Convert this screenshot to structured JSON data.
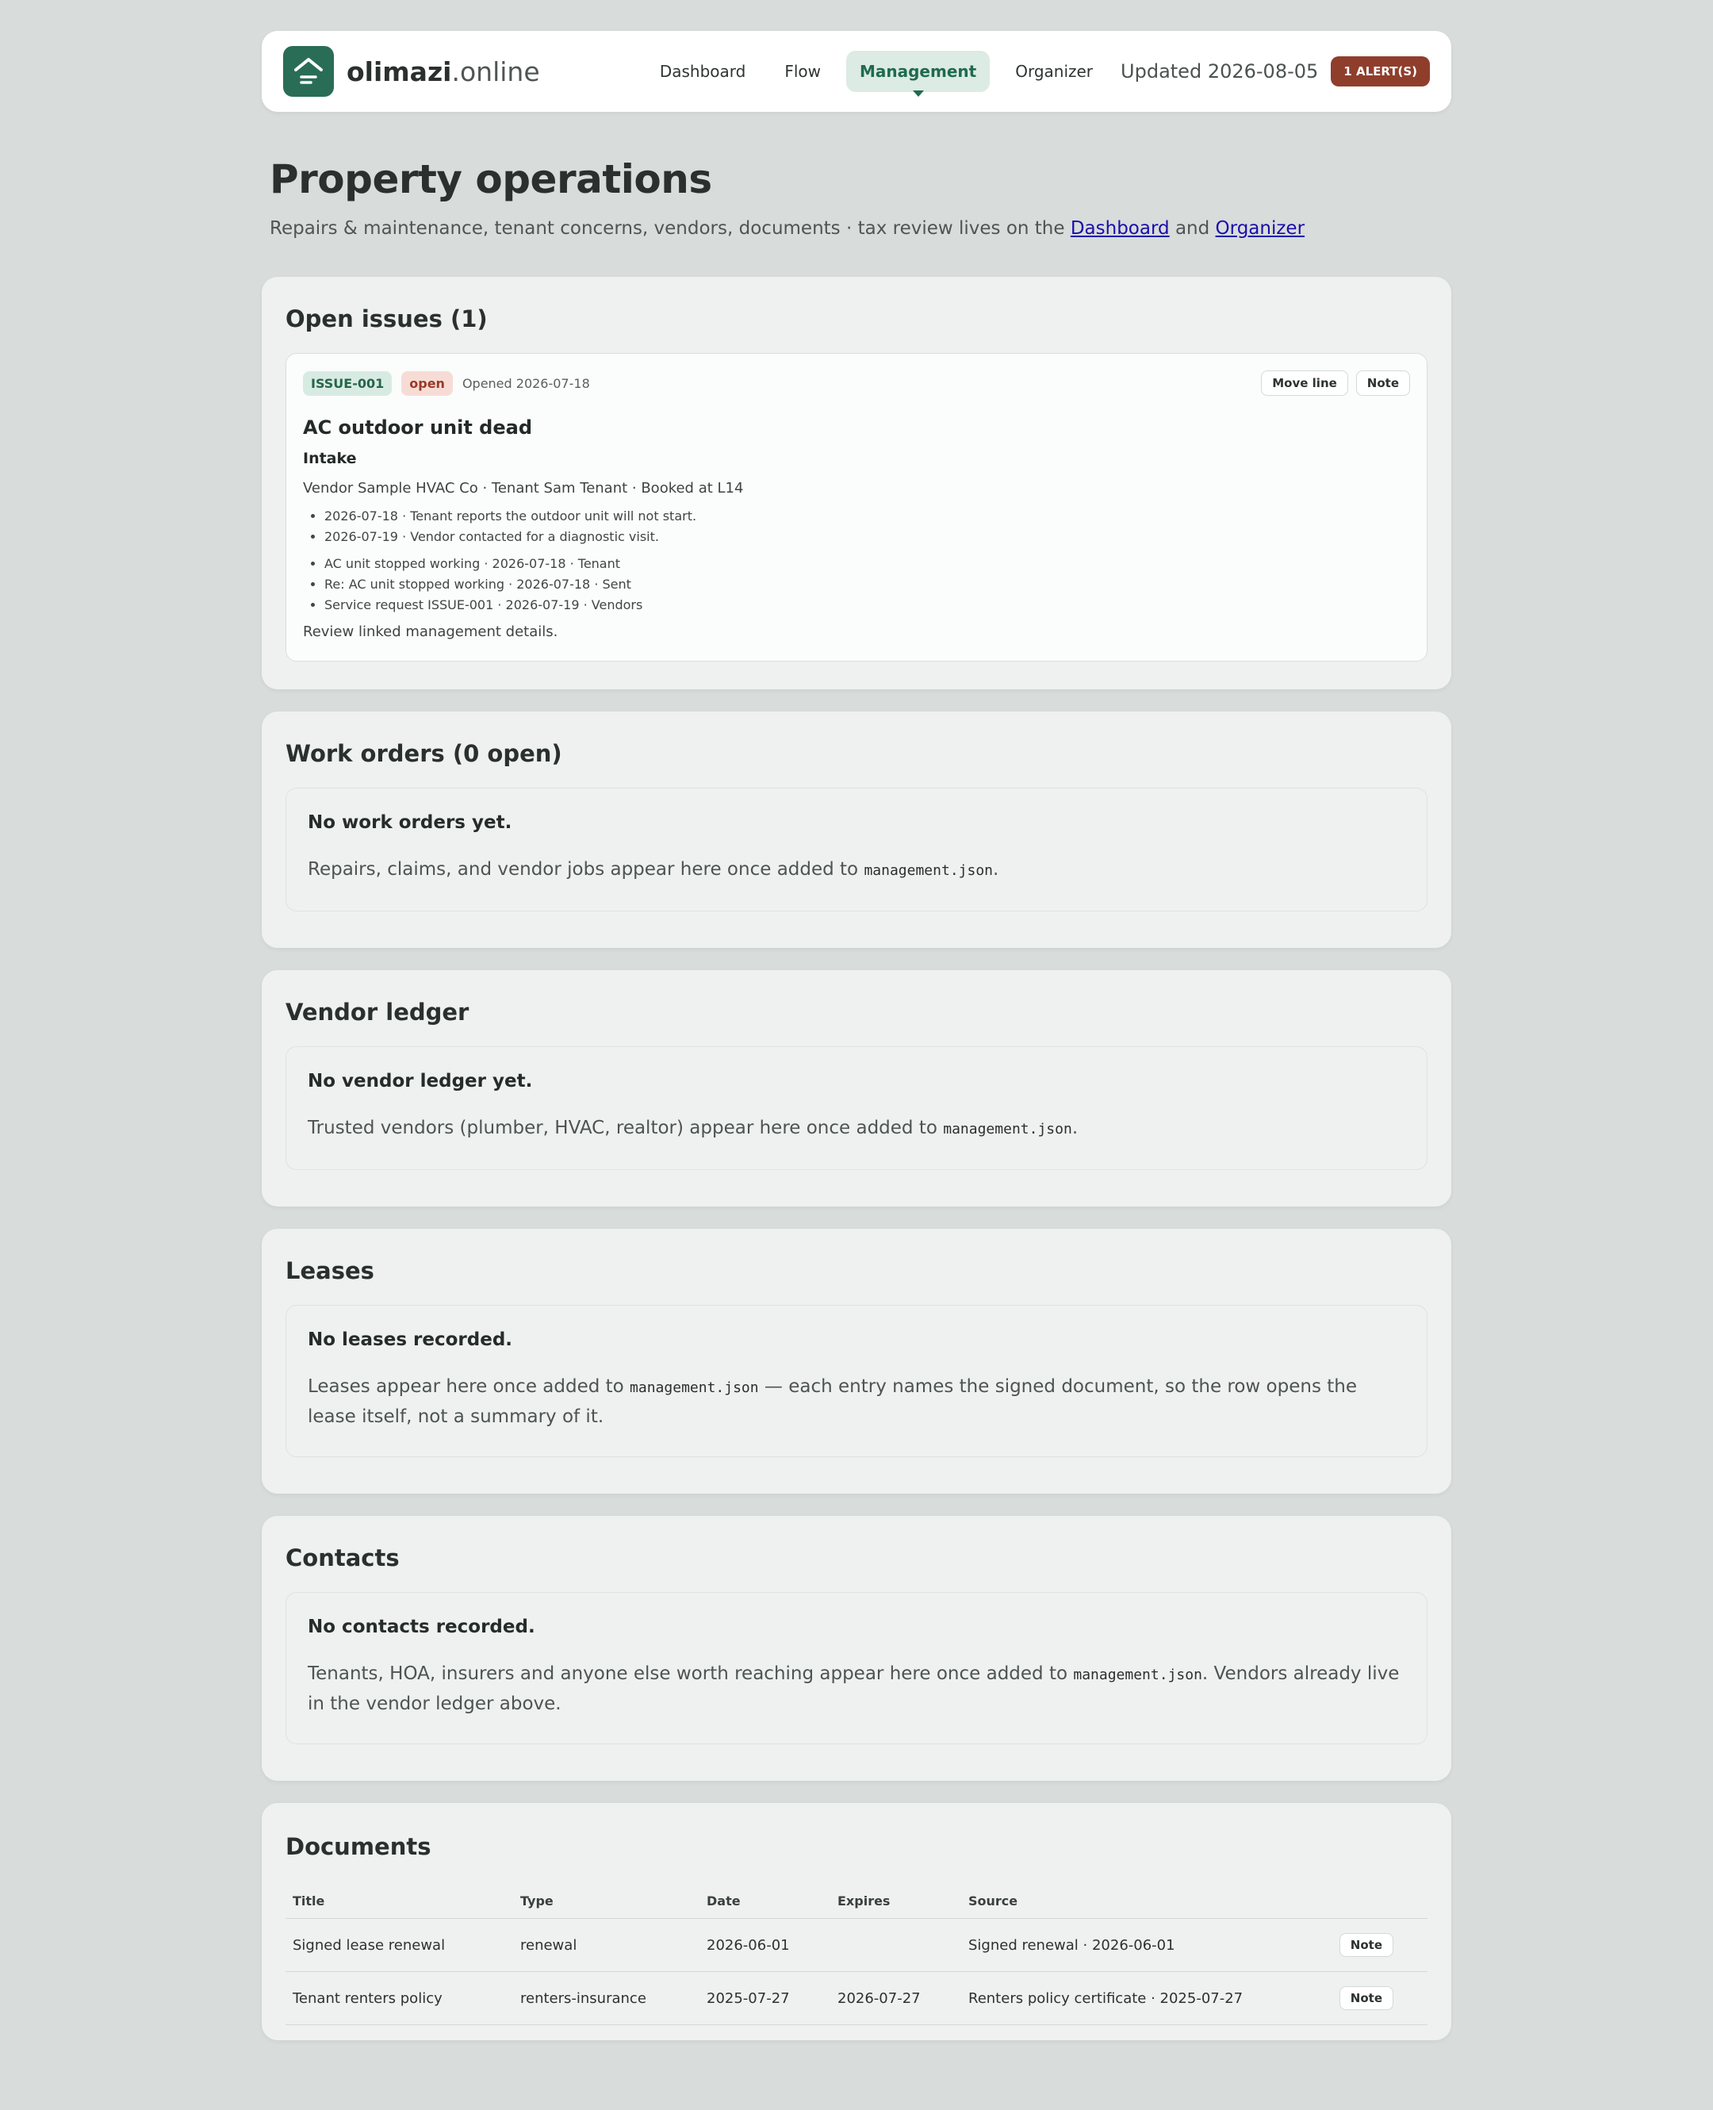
{
  "header": {
    "brand_bold": "olimazi",
    "brand_light": ".online",
    "nav": [
      {
        "label": "Dashboard"
      },
      {
        "label": "Flow"
      },
      {
        "label": "Management"
      },
      {
        "label": "Organizer"
      }
    ],
    "updated": "Updated 2026-08-05",
    "alerts": "1 ALERT(S)"
  },
  "page": {
    "title": "Property operations",
    "subtitle_prefix": "Repairs & maintenance, tenant concerns, vendors, documents · tax review lives on the ",
    "link_dashboard": "Dashboard",
    "subtitle_and": " and ",
    "link_organizer": "Organizer"
  },
  "issues": {
    "heading": "Open issues (1)",
    "items": [
      {
        "id": "ISSUE-001",
        "status": "open",
        "opened": "Opened 2026-07-18",
        "move_label": "Move line",
        "note_label": "Note",
        "title": "AC outdoor unit dead",
        "stage": "Intake",
        "meta": "Vendor Sample HVAC Co · Tenant Sam Tenant · Booked at L14",
        "timeline": [
          "2026-07-18 · Tenant reports the outdoor unit will not start.",
          "2026-07-19 · Vendor contacted for a diagnostic visit."
        ],
        "links": [
          "AC unit stopped working · 2026-07-18 · Tenant",
          "Re: AC unit stopped working · 2026-07-18 · Sent",
          "Service request ISSUE-001 · 2026-07-19 · Vendors"
        ],
        "footer": "Review linked management details."
      }
    ]
  },
  "work_orders": {
    "heading": "Work orders (0 open)",
    "empty_title": "No work orders yet.",
    "empty_text_pre": "Repairs, claims, and vendor jobs appear here once added to ",
    "code": "management.json",
    "empty_text_post": "."
  },
  "vendors": {
    "heading": "Vendor ledger",
    "empty_title": "No vendor ledger yet.",
    "empty_text_pre": "Trusted vendors (plumber, HVAC, realtor) appear here once added to ",
    "code": "management.json",
    "empty_text_post": "."
  },
  "leases": {
    "heading": "Leases",
    "empty_title": "No leases recorded.",
    "empty_text_pre": "Leases appear here once added to ",
    "code": "management.json",
    "empty_text_post": " — each entry names the signed document, so the row opens the lease itself, not a summary of it."
  },
  "contacts": {
    "heading": "Contacts",
    "empty_title": "No contacts recorded.",
    "empty_text_pre": "Tenants, HOA, insurers and anyone else worth reaching appear here once added to ",
    "code": "management.json",
    "empty_text_post": ". Vendors already live in the vendor ledger above."
  },
  "documents": {
    "heading": "Documents",
    "columns": [
      "Title",
      "Type",
      "Date",
      "Expires",
      "Source"
    ],
    "rows": [
      {
        "title": "Signed lease renewal",
        "type": "renewal",
        "date": "2026-06-01",
        "expires": "",
        "source": "Signed renewal · 2026-06-01",
        "action": "Note"
      },
      {
        "title": "Tenant renters policy",
        "type": "renters-insurance",
        "date": "2025-07-27",
        "expires": "2026-07-27",
        "source": "Renters policy certificate · 2025-07-27",
        "action": "Note"
      }
    ]
  },
  "colors": {
    "accent": "#2a6d56",
    "alert": "#8f3e2c",
    "background": "#d8dcdb"
  }
}
